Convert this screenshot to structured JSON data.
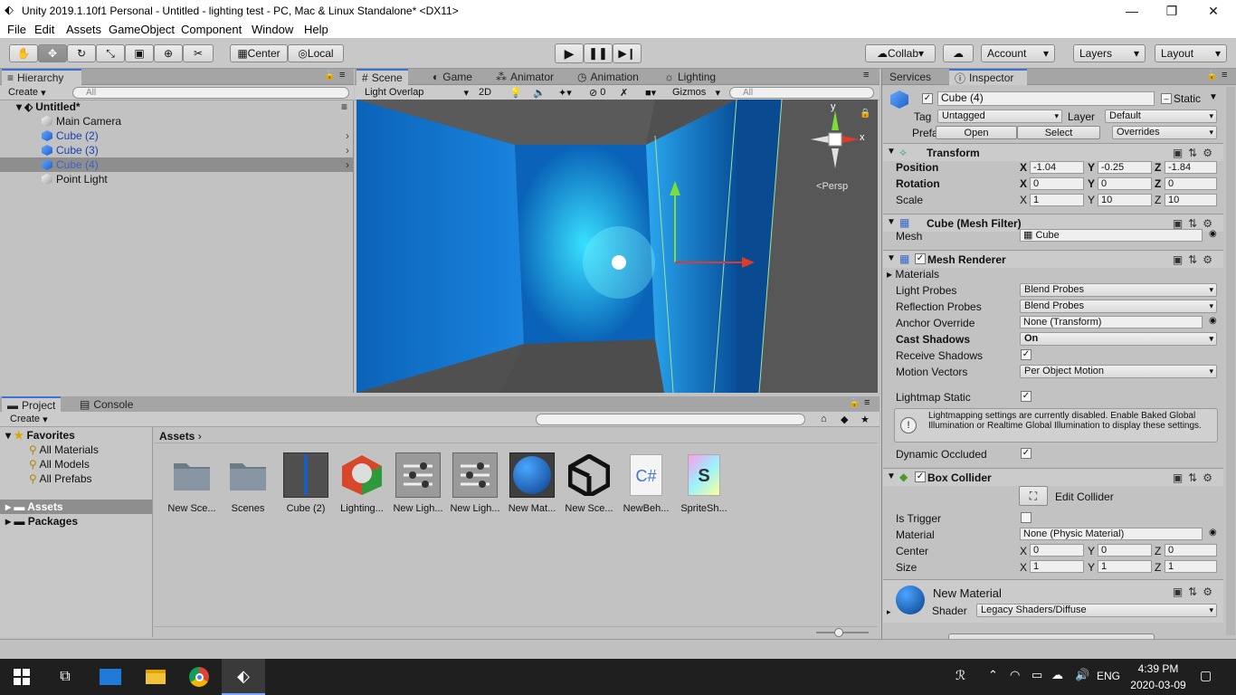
{
  "title": "Unity 2019.1.10f1 Personal - Untitled - lighting test - PC, Mac & Linux Standalone* <DX11>",
  "window_controls": {
    "min": "—",
    "max": "❐",
    "close": "✕"
  },
  "menu": [
    "File",
    "Edit",
    "Assets",
    "GameObject",
    "Component",
    "Window",
    "Help"
  ],
  "toolbar": {
    "center": "Center",
    "local": "Local",
    "collab": "Collab",
    "account": "Account",
    "layers": "Layers",
    "layout": "Layout"
  },
  "hierarchy": {
    "tab": "Hierarchy",
    "create": "Create",
    "search": "All",
    "scene": "Untitled*",
    "items": [
      "Main Camera",
      "Cube (2)",
      "Cube (3)",
      "Cube (4)",
      "Point Light"
    ]
  },
  "scene_tabs": {
    "scene": "Scene",
    "game": "Game",
    "animator": "Animator",
    "animation": "Animation",
    "lighting": "Lighting"
  },
  "scene_bar": {
    "mode": "Light Overlap",
    "two_d": "2D",
    "hidden": "0",
    "gizmos": "Gizmos",
    "search": "All",
    "persp": "Persp",
    "gizmo_y": "y",
    "gizmo_x": "x"
  },
  "project": {
    "tab": "Project",
    "console": "Console",
    "create": "Create",
    "favorites": "Favorites",
    "fav_items": [
      "All Materials",
      "All Models",
      "All Prefabs"
    ],
    "assets_root": "Assets",
    "packages": "Packages",
    "breadcrumb": "Assets",
    "assets": [
      "New Sce...",
      "Scenes",
      "Cube (2)",
      "Lighting...",
      "New Ligh...",
      "New Ligh...",
      "New Mat...",
      "New Sce...",
      "NewBeh...",
      "SpriteSh..."
    ]
  },
  "inspector": {
    "services": "Services",
    "tab": "Inspector",
    "name": "Cube (4)",
    "static": "Static",
    "tag_label": "Tag",
    "tag": "Untagged",
    "layer_label": "Layer",
    "layer": "Default",
    "prefab_label": "Prefab",
    "open": "Open",
    "select": "Select",
    "overrides": "Overrides",
    "transform": {
      "title": "Transform",
      "position": "Position",
      "rotation": "Rotation",
      "scale": "Scale",
      "px": "-1.04",
      "py": "-0.25",
      "pz": "-1.84",
      "rx": "0",
      "ry": "0",
      "rz": "0",
      "sx": "1",
      "sy": "10",
      "sz": "10",
      "X": "X",
      "Y": "Y",
      "Z": "Z"
    },
    "mesh_filter": {
      "title": "Cube (Mesh Filter)",
      "mesh_label": "Mesh",
      "mesh": "Cube"
    },
    "mesh_renderer": {
      "title": "Mesh Renderer",
      "materials": "Materials",
      "light_probes": "Light Probes",
      "light_probes_v": "Blend Probes",
      "refl": "Reflection Probes",
      "refl_v": "Blend Probes",
      "anchor": "Anchor Override",
      "anchor_v": "None (Transform)",
      "cast": "Cast Shadows",
      "cast_v": "On",
      "receive": "Receive Shadows",
      "motion": "Motion Vectors",
      "motion_v": "Per Object Motion",
      "lightmap": "Lightmap Static",
      "info": "Lightmapping settings are currently disabled. Enable Baked Global Illumination or Realtime Global Illumination to display these settings.",
      "dyn": "Dynamic Occluded"
    },
    "box_collider": {
      "title": "Box Collider",
      "edit": "Edit Collider",
      "trigger": "Is Trigger",
      "material": "Material",
      "material_v": "None (Physic Material)",
      "center": "Center",
      "size": "Size",
      "cx": "0",
      "cy": "0",
      "cz": "0",
      "szx": "1",
      "szy": "1",
      "szz": "1"
    },
    "material": {
      "name": "New Material",
      "shader_label": "Shader",
      "shader": "Legacy Shaders/Diffuse"
    }
  },
  "taskbar": {
    "lang": "ENG",
    "time": "4:39 PM",
    "date": "2020-03-09"
  }
}
